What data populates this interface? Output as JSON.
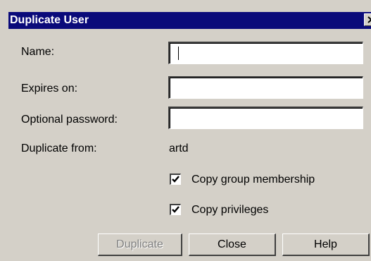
{
  "dialog": {
    "title": "Duplicate User"
  },
  "form": {
    "name_label": "Name:",
    "name_value": "",
    "expires_label": "Expires on:",
    "expires_value": "",
    "password_label": "Optional password:",
    "password_value": "",
    "duplicate_from_label": "Duplicate from:",
    "duplicate_from_value": "artd"
  },
  "options": {
    "copy_group_label": "Copy group membership",
    "copy_group_checked": true,
    "copy_privileges_label": "Copy privileges",
    "copy_privileges_checked": true
  },
  "buttons": {
    "duplicate_label": "Duplicate",
    "duplicate_enabled": false,
    "close_label": "Close",
    "help_label": "Help"
  },
  "colors": {
    "titlebar": "#0a0a7a",
    "dialog_bg": "#d4d0c8"
  }
}
